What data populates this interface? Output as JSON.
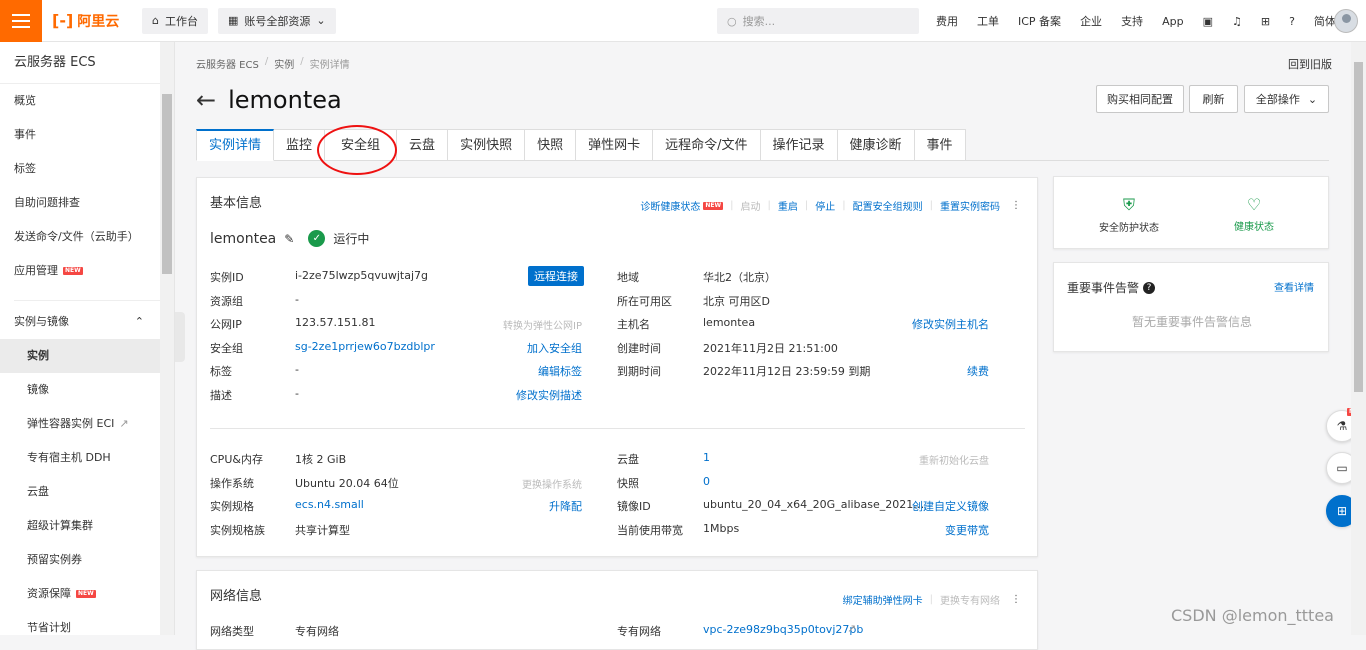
{
  "topbar": {
    "logo_text": "阿里云",
    "workbench": "工作台",
    "resources": "账号全部资源",
    "search_placeholder": "搜索...",
    "nav": [
      "费用",
      "工单",
      "ICP 备案",
      "企业",
      "支持",
      "App",
      "简体"
    ]
  },
  "sidebar": {
    "title": "云服务器 ECS",
    "items": [
      "概览",
      "事件",
      "标签",
      "自助问题排查",
      "发送命令/文件（云助手）",
      "应用管理"
    ],
    "group": "实例与镜像",
    "sub_items": [
      "实例",
      "镜像",
      "弹性容器实例 ECI",
      "专有宿主机 DDH",
      "云盘",
      "超级计算集群",
      "预留实例券",
      "资源保障",
      "节省计划"
    ],
    "new_badge": "NEW"
  },
  "breadcrumb": [
    "云服务器 ECS",
    "实例",
    "实例详情"
  ],
  "back_old": "回到旧版",
  "title": "lemontea",
  "buttons": {
    "buy_same": "购买相同配置",
    "refresh": "刷新",
    "all_ops": "全部操作"
  },
  "tabs": [
    "实例详情",
    "监控",
    "安全组",
    "云盘",
    "实例快照",
    "快照",
    "弹性网卡",
    "远程命令/文件",
    "操作记录",
    "健康诊断",
    "事件"
  ],
  "basic": {
    "header": "基本信息",
    "actions": {
      "diagnose": "诊断健康状态",
      "start": "启动",
      "restart": "重启",
      "stop": "停止",
      "config_sg": "配置安全组规则",
      "reset_pwd": "重置实例密码"
    },
    "name": "lemontea",
    "status": "运行中",
    "remote": "远程连接",
    "labels": {
      "id": "实例ID",
      "rg": "资源组",
      "pip": "公网IP",
      "sg": "安全组",
      "tag": "标签",
      "desc": "描述",
      "region": "地域",
      "zone": "所在可用区",
      "host": "主机名",
      "created": "创建时间",
      "expire": "到期时间",
      "cpu": "CPU&内存",
      "os": "操作系统",
      "spec": "实例规格",
      "family": "实例规格族",
      "disk": "云盘",
      "snap": "快照",
      "image": "镜像ID",
      "bw": "当前使用带宽"
    },
    "values": {
      "id": "i-2ze75lwzp5qvuwjtaj7g",
      "rg": "-",
      "pip": "123.57.151.81",
      "sg": "sg-2ze1prrjew6o7bzdblpr",
      "tag": "-",
      "desc": "-",
      "region": "华北2（北京）",
      "zone": "北京 可用区D",
      "host": "lemontea",
      "created": "2021年11月2日 21:51:00",
      "expire": "2022年11月12日 23:59:59 到期",
      "cpu": "1核 2 GiB",
      "os": "Ubuntu 20.04 64位",
      "spec": "ecs.n4.small",
      "family": "共享计算型",
      "disk": "1",
      "snap": "0",
      "image": "ubuntu_20_04_x64_20G_alibase_2021…",
      "bw": "1Mbps"
    },
    "links": {
      "to_eip": "转换为弹性公网IP",
      "join_sg": "加入安全组",
      "edit_tag": "编辑标签",
      "edit_desc": "修改实例描述",
      "edit_host": "修改实例主机名",
      "renew": "续费",
      "change_os": "更换操作系统",
      "upgrade": "升降配",
      "reinit": "重新初始化云盘",
      "custom_img": "创建自定义镜像",
      "change_bw": "变更带宽"
    }
  },
  "status_card": {
    "security": "安全防护状态",
    "health": "健康状态"
  },
  "event_card": {
    "title": "重要事件告警",
    "view": "查看详情",
    "empty": "暂无重要事件告警信息"
  },
  "net": {
    "header": "网络信息",
    "bind_eni": "绑定辅助弹性网卡",
    "change_vpc": "更换专有网络",
    "type_label": "网络类型",
    "type_value": "专有网络",
    "vpc_label": "专有网络",
    "vpc_value": "vpc-2ze98z9bq35p0tovj27pb"
  },
  "watermark": "CSDN @lemon_tttea"
}
